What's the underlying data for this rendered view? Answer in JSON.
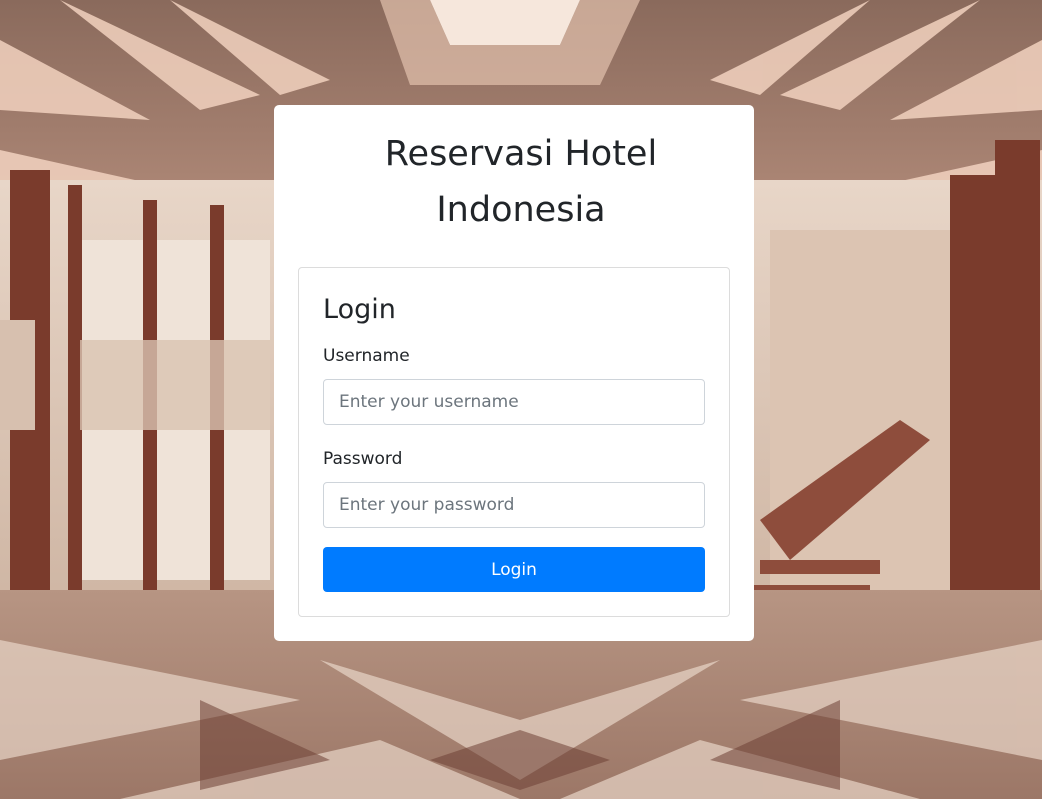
{
  "page": {
    "title_line1": "Reservasi Hotel",
    "title_line2": "Indonesia"
  },
  "login_form": {
    "heading": "Login",
    "username_label": "Username",
    "username_placeholder": "Enter your username",
    "username_value": "",
    "password_label": "Password",
    "password_placeholder": "Enter your password",
    "password_value": "",
    "submit_label": "Login"
  },
  "colors": {
    "primary_button": "#007bff",
    "card_background": "#ffffff",
    "text": "#212529"
  },
  "background": {
    "description_icon": "hotel-lobby-photo"
  }
}
